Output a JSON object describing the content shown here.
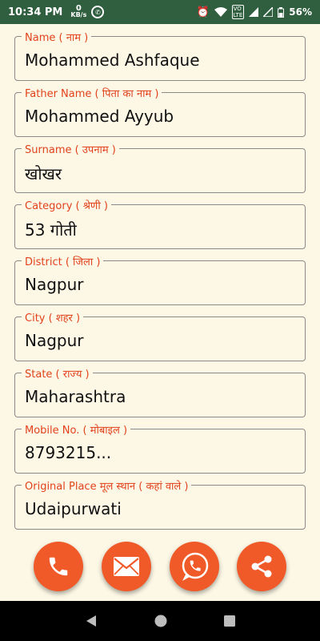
{
  "status_bar": {
    "time": "10:34 PM",
    "data_rate_value": "0",
    "data_rate_unit": "KB/s",
    "battery": "56%"
  },
  "fields": [
    {
      "label": "Name ( नाम )",
      "value": "Mohammed Ashfaque"
    },
    {
      "label": "Father Name ( पिता का नाम )",
      "value": "Mohammed Ayyub"
    },
    {
      "label": "Surname ( उपनाम )",
      "value": "खोखर"
    },
    {
      "label": "Category ( श्रेणी )",
      "value": "53 गोती"
    },
    {
      "label": "District ( जिला )",
      "value": "Nagpur"
    },
    {
      "label": "City ( शहर )",
      "value": "Nagpur"
    },
    {
      "label": "State ( राज्य )",
      "value": "Maharashtra"
    },
    {
      "label": "Mobile No. ( मोबाइल )",
      "value": "8793215..."
    },
    {
      "label": "Original Place मूल स्थान ( कहां वाले )",
      "value": "Udaipurwati"
    }
  ],
  "actions": {
    "icons": [
      "phone-icon",
      "mail-icon",
      "whatsapp-icon",
      "share-icon"
    ]
  },
  "colors": {
    "accent": "#f05a28",
    "label": "#e1421b",
    "background": "#fdf8e6",
    "status_bar": "#2f5f3e"
  }
}
